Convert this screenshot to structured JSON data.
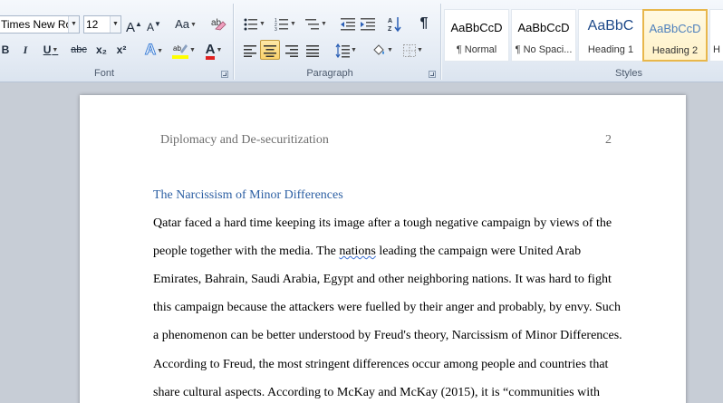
{
  "font": {
    "name": "Times New Roman",
    "size": "12",
    "group_label": "Font",
    "grow_label": "A",
    "shrink_label": "A",
    "case_label": "Aa",
    "bold": "B",
    "italic": "I",
    "underline": "U",
    "strike": "abc",
    "subscript": "x₂",
    "superscript": "x²",
    "font_color_label": "A"
  },
  "paragraph": {
    "group_label": "Paragraph"
  },
  "styles": {
    "group_label": "Styles",
    "items": [
      {
        "preview": "AaBbCcD",
        "name": "¶ Normal"
      },
      {
        "preview": "AaBbCcD",
        "name": "¶ No Spaci..."
      },
      {
        "preview": "AaBbC",
        "name": "Heading 1"
      },
      {
        "preview": "AaBbCcD",
        "name": "Heading 2"
      },
      {
        "preview": "",
        "name": "H"
      }
    ]
  },
  "document": {
    "header": "Diplomacy and De-securitization",
    "page_number": "2",
    "heading": "The Narcissism of Minor Differences",
    "lines": [
      " Qatar faced a hard time keeping its image after a tough negative campaign by views of the",
      "people together with the media. The ",
      "nations",
      " leading the campaign were United Arab",
      "Emirates, Bahrain, Saudi Arabia, Egypt and other neighboring nations. It was hard to fight",
      "this campaign because the attackers were fuelled by their anger and probably, by envy. Such",
      "a phenomenon can be better understood by Freud's theory, Narcissism of Minor Differences.",
      "According to Freud, the most stringent differences occur among people and countries that",
      "share cultural aspects. According to McKay and McKay (2015), it is “communities with"
    ]
  },
  "colors": {
    "heading": "#2c5fa3",
    "highlight": "#ffff00",
    "font_color": "#e02020",
    "active_style_border": "#e8b74c"
  }
}
